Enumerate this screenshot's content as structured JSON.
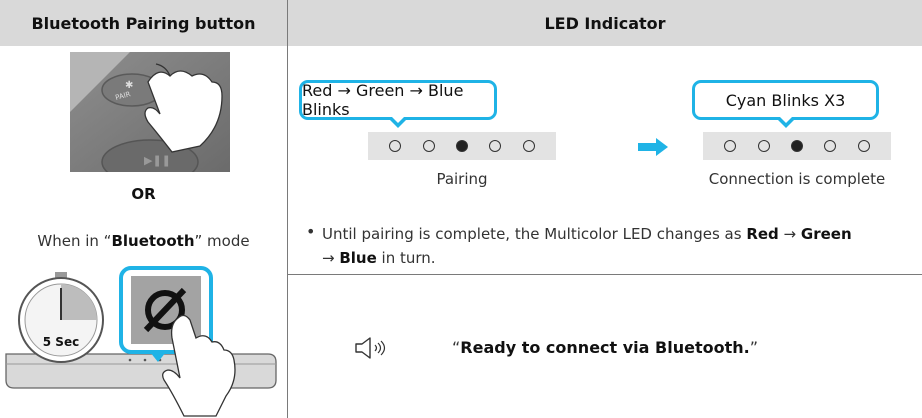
{
  "table": {
    "col1_header": "Bluetooth Pairing button",
    "col2_header": "LED Indicator"
  },
  "left": {
    "pair_label": "PAIR",
    "or_label": "OR",
    "mode_prefix": "When in “",
    "mode_name": "Bluetooth",
    "mode_suffix": "” mode",
    "timer_label": "5 Sec"
  },
  "led": {
    "bubble1": "Red → Green → Blue Blinks",
    "bubble2": "Cyan Blinks X3",
    "caption1": "Pairing",
    "caption2": "Connection is complete",
    "led_states": [
      false,
      false,
      true,
      false,
      false
    ]
  },
  "note": {
    "prefix": "Until pairing is complete, the Multicolor LED changes as ",
    "red": "Red",
    "arrow1": " → ",
    "green": "Green",
    "arrow2": "→ ",
    "blue": "Blue",
    "suffix": " in turn."
  },
  "voice": {
    "icon": "speaker-icon",
    "open_quote": "“",
    "message": "Ready to connect via Bluetooth.",
    "close_quote": "”"
  },
  "colors": {
    "accent": "#1fb3e6",
    "header_bg": "#d9d9d9",
    "led_bar_bg": "#e3e3e3"
  }
}
